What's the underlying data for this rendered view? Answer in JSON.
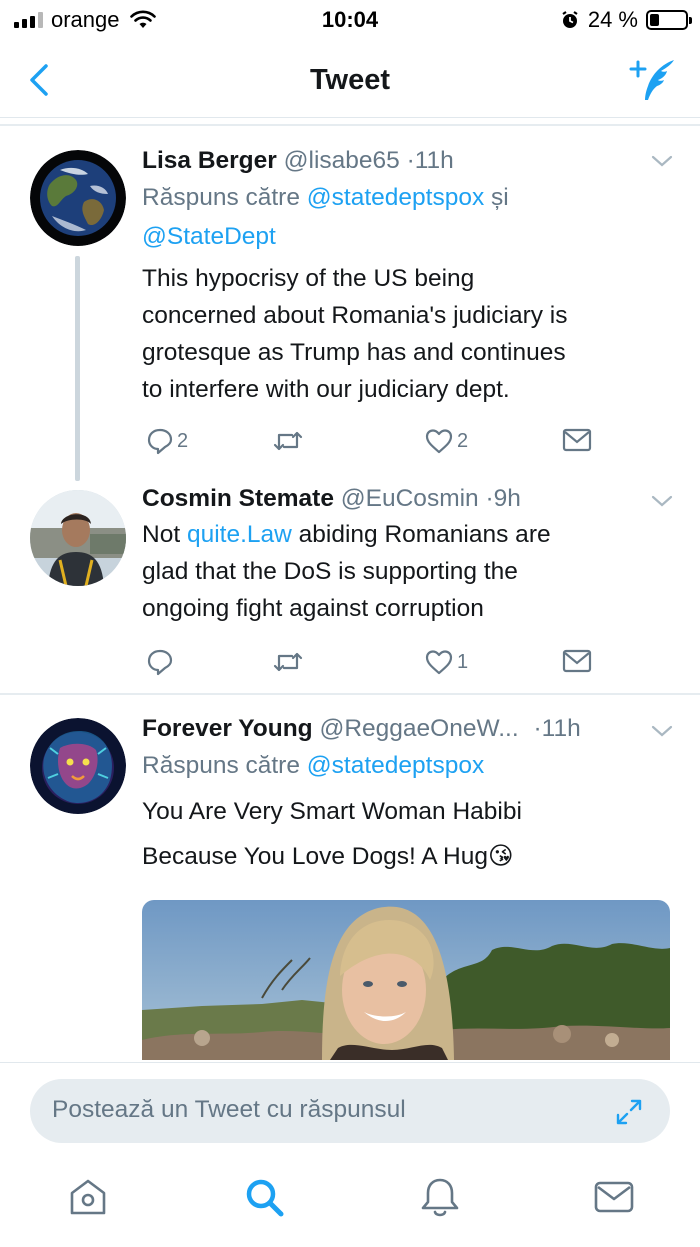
{
  "status_bar": {
    "carrier": "orange",
    "time": "10:04",
    "battery_text": "24 %",
    "battery_level_percent": 24
  },
  "nav": {
    "title": "Tweet",
    "back_icon": "chevron-left-icon",
    "compose_icon": "compose-tweet-icon"
  },
  "tweets": [
    {
      "name": "Lisa Berger",
      "handle": "@lisabe65",
      "time": "11h",
      "reply_prefix": "Răspuns către",
      "reply_to_1": "@statedeptspox",
      "reply_conj": "și",
      "reply_to_2": "@StateDept",
      "text_lines": [
        "This hypocrisy of the US being",
        "concerned about Romania's judiciary is",
        "grotesque as Trump has and continues",
        "to interfere with our judiciary dept."
      ],
      "reply_count": "2",
      "retweet_count": "",
      "like_count": "2"
    },
    {
      "name": "Cosmin Stemate",
      "handle": "@EuCosmin",
      "time": "9h",
      "line1_pre": "Not ",
      "line1_link": "quite.Law",
      "line1_post": " abiding Romanians are",
      "text_lines_rest": [
        "glad that the DoS is supporting the",
        "ongoing fight against corruption"
      ],
      "reply_count": "",
      "retweet_count": "",
      "like_count": "1"
    },
    {
      "name": "Forever Young",
      "handle": "@ReggaeOneW...",
      "time": "11h",
      "reply_prefix": "Răspuns către",
      "reply_to_1": "@statedeptspox",
      "text_line1": "You Are Very Smart Woman Habibi",
      "text_line2": "Because You Love Dogs! A Hug",
      "emoji": "😘"
    }
  ],
  "reply_box": {
    "placeholder": "Postează un Tweet cu răspunsul"
  },
  "colors": {
    "accent": "#1da1f2",
    "secondary_text": "#657786",
    "divider": "#e6ecf0"
  }
}
